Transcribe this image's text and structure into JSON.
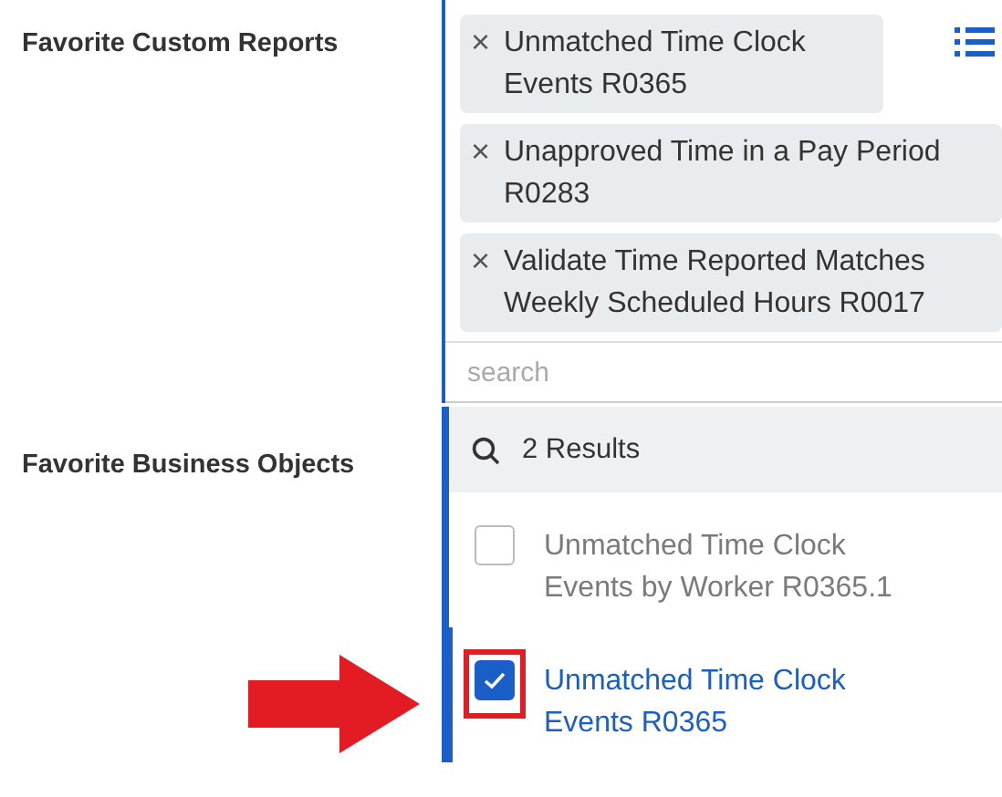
{
  "favorite_custom_reports": {
    "label": "Favorite Custom Reports",
    "tags": [
      {
        "remove": "×",
        "text": "Unmatched Time Clock Events R0365"
      },
      {
        "remove": "×",
        "text": "Unapproved Time in a Pay Period R0283"
      },
      {
        "remove": "×",
        "text": "Validate Time Reported Matches Weekly Scheduled Hours R0017"
      }
    ],
    "search": {
      "placeholder": "search"
    }
  },
  "favorite_business_objects": {
    "label": "Favorite Business Objects",
    "results": "2 Results",
    "items": [
      {
        "text": "Unmatched Time Clock Events by Worker R0365.1",
        "checked": false,
        "selected": false,
        "annotated": false
      },
      {
        "text": "Unmatched Time Clock Events R0365",
        "checked": true,
        "selected": true,
        "annotated": true
      }
    ]
  }
}
